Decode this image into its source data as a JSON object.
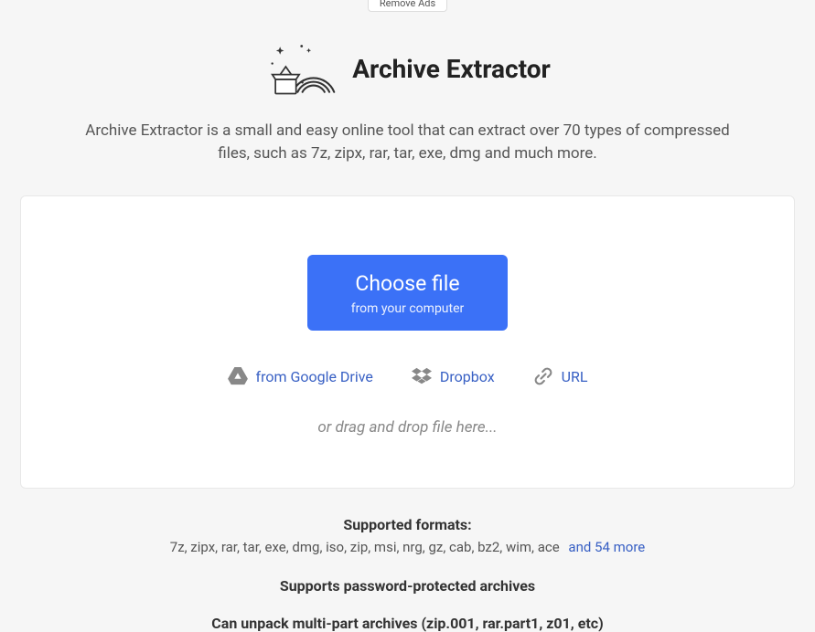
{
  "top_pill": "Remove Ads",
  "header": {
    "title": "Archive Extractor",
    "description": "Archive Extractor is a small and easy online tool that can extract over 70 types of compressed files, such as 7z, zipx, rar, tar, exe, dmg and much more."
  },
  "upload": {
    "choose_label": "Choose file",
    "choose_sub": "from your computer",
    "google_drive": "from Google Drive",
    "dropbox": "Dropbox",
    "url": "URL",
    "dragdrop": "or drag and drop file here..."
  },
  "footer": {
    "supported_heading": "Supported formats:",
    "supported_list": "7z, zipx, rar, tar, exe, dmg, iso, zip, msi, nrg, gz, cab, bz2, wim, ace",
    "more_link": "and 54 more",
    "password_line": "Supports password-protected archives",
    "multipart_line": "Can unpack multi-part archives (zip.001, rar.part1, z01, etc)"
  }
}
